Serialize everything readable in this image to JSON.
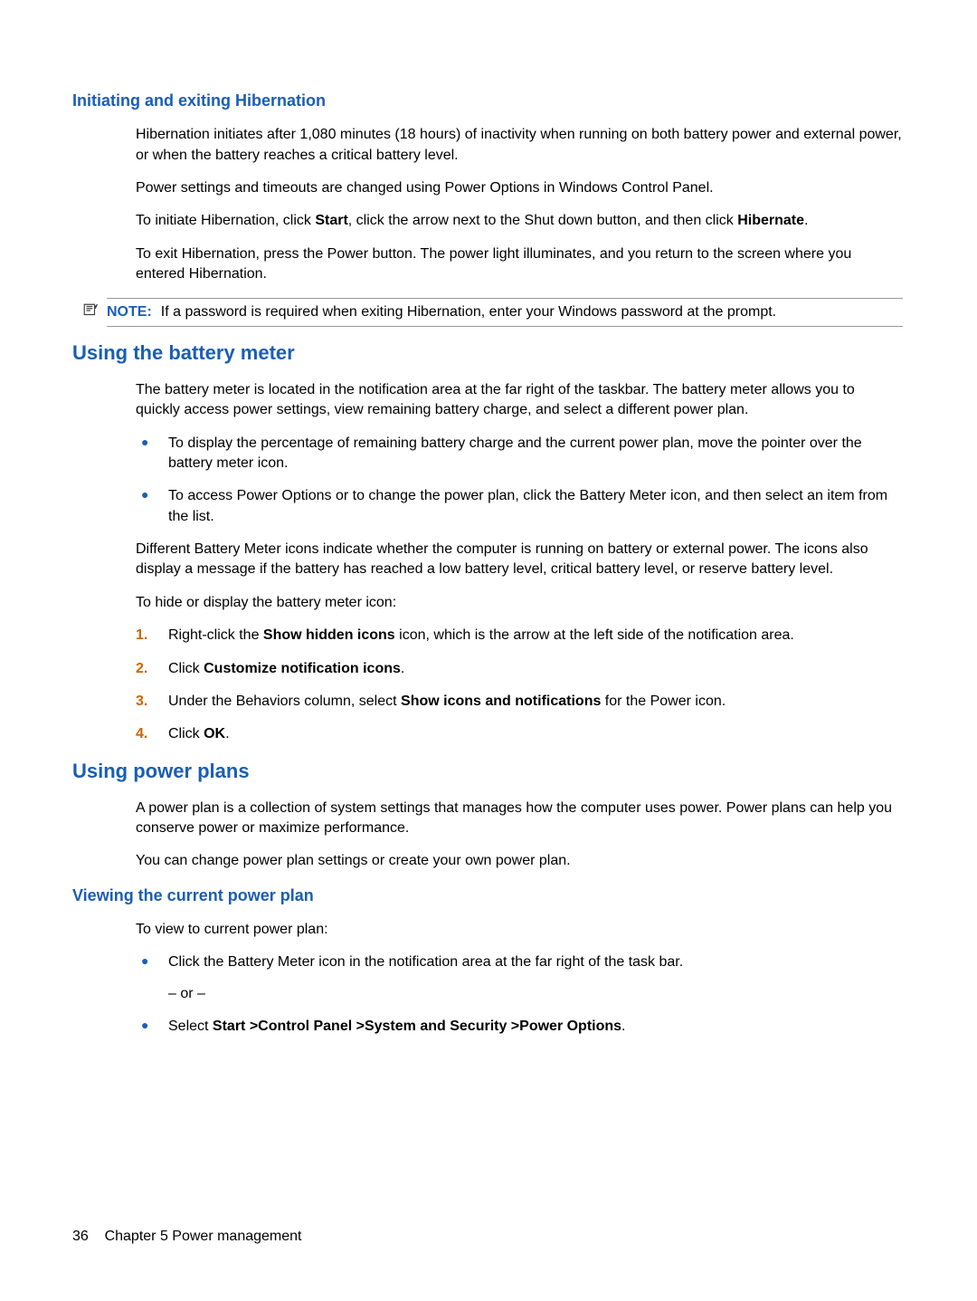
{
  "section1": {
    "heading": "Initiating and exiting Hibernation",
    "p1": "Hibernation initiates after 1,080 minutes (18 hours) of inactivity when running on both battery power and external power, or when the battery reaches a critical battery level.",
    "p2": "Power settings and timeouts are changed using Power Options in Windows Control Panel.",
    "p3_a": "To initiate Hibernation, click ",
    "p3_b": "Start",
    "p3_c": ", click the arrow next to the Shut down button, and then click ",
    "p3_d": "Hibernate",
    "p3_e": ".",
    "p4": "To exit Hibernation, press the Power button. The power light illuminates, and you return to the screen where you entered Hibernation.",
    "note_label": "NOTE:",
    "note_text": "If a password is required when exiting Hibernation, enter your Windows password at the prompt."
  },
  "section2": {
    "heading": "Using the battery meter",
    "p1": "The battery meter is located in the notification area at the far right of the taskbar. The battery meter allows you to quickly access power settings, view remaining battery charge, and select a different power plan.",
    "bullets": [
      "To display the percentage of remaining battery charge and the current power plan, move the pointer over the battery meter icon.",
      "To access Power Options or to change the power plan, click the Battery Meter icon, and then select an item from the list."
    ],
    "p2": "Different Battery Meter icons indicate whether the computer is running on battery or external power. The icons also display a message if the battery has reached a low battery level, critical battery level, or reserve battery level.",
    "p3": "To hide or display the battery meter icon:",
    "steps": {
      "s1_a": "Right-click the ",
      "s1_b": "Show hidden icons",
      "s1_c": " icon, which is the arrow at the left side of the notification area.",
      "s2_a": "Click ",
      "s2_b": "Customize notification icons",
      "s2_c": ".",
      "s3_a": "Under the Behaviors column, select ",
      "s3_b": "Show icons and notifications",
      "s3_c": " for the Power icon.",
      "s4_a": "Click ",
      "s4_b": "OK",
      "s4_c": "."
    }
  },
  "section3": {
    "heading": "Using power plans",
    "p1": "A power plan is a collection of system settings that manages how the computer uses power. Power plans can help you conserve power or maximize performance.",
    "p2": "You can change power plan settings or create your own power plan."
  },
  "section4": {
    "heading": "Viewing the current power plan",
    "p1": "To view to current power plan:",
    "bullets": {
      "b1": "Click the Battery Meter icon in the notification area at the far right of the task bar.",
      "or": "– or –",
      "b2_a": "Select ",
      "b2_b": "Start >Control Panel >System and Security >Power Options",
      "b2_c": "."
    }
  },
  "footer": {
    "page": "36",
    "chapter": "Chapter 5   Power management"
  }
}
